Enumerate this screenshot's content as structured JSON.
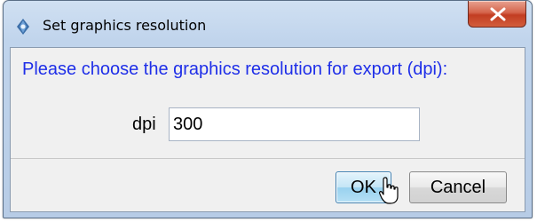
{
  "window": {
    "title": "Set graphics resolution",
    "icon": "java-app-icon",
    "close_icon": "close-icon"
  },
  "dialog": {
    "prompt": "Please choose the graphics resolution for export (dpi):",
    "dpi_label": "dpi",
    "dpi_value": "300"
  },
  "buttons": {
    "ok_label": "OK",
    "cancel_label": "Cancel"
  },
  "colors": {
    "prompt_text": "#1f2fe8",
    "close_button": "#c23d22",
    "title_bar": "#c0d4ec"
  }
}
